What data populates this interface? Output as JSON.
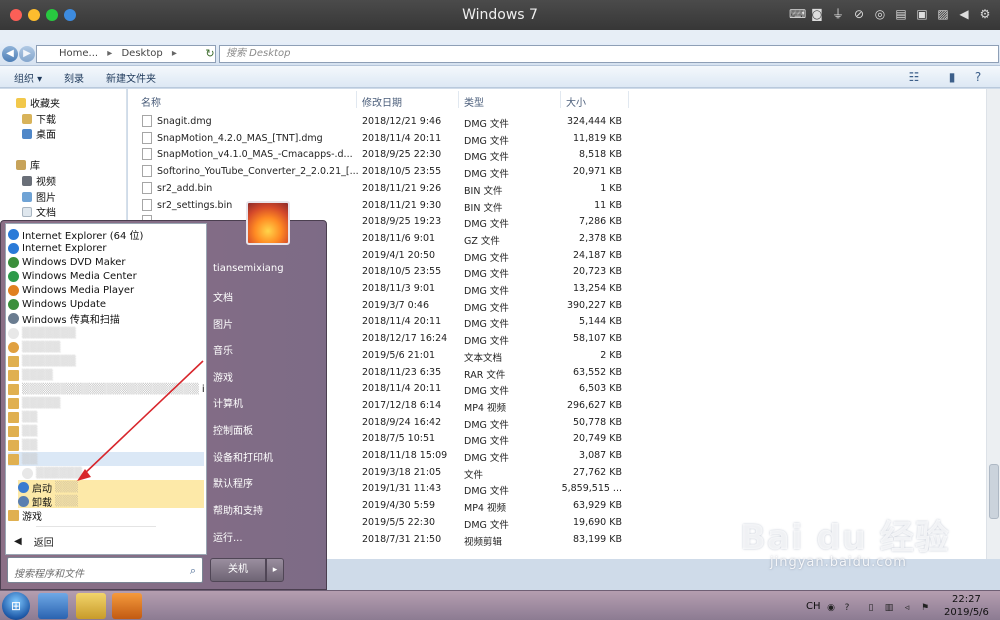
{
  "mac": {
    "title": "Windows 7"
  },
  "address": {
    "seg1": "Home...",
    "seg2": "Desktop",
    "search_placeholder": "搜索 Desktop"
  },
  "toolbar": {
    "organize": "组织 ▾",
    "burn": "刻录",
    "new_folder": "新建文件夹"
  },
  "nav": {
    "favorites": "收藏夹",
    "downloads": "下载",
    "desktop": "桌面",
    "libraries": "库",
    "videos": "视频",
    "pictures": "图片",
    "documents": "文档"
  },
  "columns": {
    "name": "名称",
    "date": "修改日期",
    "type": "类型",
    "size": "大小"
  },
  "files": [
    {
      "name": "Snagit.dmg",
      "date": "2018/12/21 9:46",
      "type": "DMG 文件",
      "size": "324,444 KB"
    },
    {
      "name": "SnapMotion_4.2.0_MAS_[TNT].dmg",
      "date": "2018/11/4 20:11",
      "type": "DMG 文件",
      "size": "11,819 KB"
    },
    {
      "name": "SnapMotion_v4.1.0_MAS_-Cmacapps-.d...",
      "date": "2018/9/25 22:30",
      "type": "DMG 文件",
      "size": "8,518 KB"
    },
    {
      "name": "Softorino_YouTube_Converter_2_2.0.21_[...",
      "date": "2018/10/5 23:55",
      "type": "DMG 文件",
      "size": "20,971 KB"
    },
    {
      "name": "sr2_add.bin",
      "date": "2018/11/21 9:26",
      "type": "BIN 文件",
      "size": "1 KB"
    },
    {
      "name": "sr2_settings.bin",
      "date": "2018/11/21 9:30",
      "type": "BIN 文件",
      "size": "11 KB"
    },
    {
      "name": "",
      "date": "2018/9/25 19:23",
      "type": "DMG 文件",
      "size": "7,286 KB"
    },
    {
      "name": "",
      "date": "2018/11/6 9:01",
      "type": "GZ 文件",
      "size": "2,378 KB"
    },
    {
      "name": "",
      "date": "2019/4/1 20:50",
      "type": "DMG 文件",
      "size": "24,187 KB"
    },
    {
      "name": "",
      "date": "2018/10/5 23:55",
      "type": "DMG 文件",
      "size": "20,723 KB"
    },
    {
      "name": "",
      "date": "2018/11/3 9:01",
      "type": "DMG 文件",
      "size": "13,254 KB"
    },
    {
      "name": "",
      "date": "2019/3/7 0:46",
      "type": "DMG 文件",
      "size": "390,227 KB"
    },
    {
      "name": "",
      "date": "2018/11/4 20:11",
      "type": "DMG 文件",
      "size": "5,144 KB"
    },
    {
      "name": "",
      "date": "2018/12/17 16:24",
      "type": "DMG 文件",
      "size": "58,107 KB"
    },
    {
      "name": "",
      "date": "2019/5/6 21:01",
      "type": "文本文档",
      "size": "2 KB"
    },
    {
      "name": "",
      "date": "2018/11/23 6:35",
      "type": "RAR 文件",
      "size": "63,552 KB"
    },
    {
      "name": "",
      "date": "2018/11/4 20:11",
      "type": "DMG 文件",
      "size": "6,503 KB"
    },
    {
      "name": "",
      "date": "2017/12/18 6:14",
      "type": "MP4 视频",
      "size": "296,627 KB"
    },
    {
      "name": "",
      "date": "2018/9/24 16:42",
      "type": "DMG 文件",
      "size": "50,778 KB"
    },
    {
      "name": "",
      "date": "2018/7/5 10:51",
      "type": "DMG 文件",
      "size": "20,749 KB"
    },
    {
      "name": "",
      "date": "2018/11/18 15:09",
      "type": "DMG 文件",
      "size": "3,087 KB"
    },
    {
      "name": "",
      "date": "2019/3/18 21:05",
      "type": "文件",
      "size": "27,762 KB"
    },
    {
      "name": "",
      "date": "2019/1/31 11:43",
      "type": "DMG 文件",
      "size": "5,859,515 ..."
    },
    {
      "name": "",
      "date": "2019/4/30 5:59",
      "type": "MP4 视频",
      "size": "63,929 KB"
    },
    {
      "name": "",
      "date": "2019/5/5 22:30",
      "type": "DMG 文件",
      "size": "19,690 KB"
    },
    {
      "name": "",
      "date": "2018/7/31 21:50",
      "type": "视频剪辑",
      "size": "83,199 KB"
    }
  ],
  "start_menu": {
    "programs": [
      {
        "label": "Internet Explorer (64 位)",
        "color": "#2a7ad8"
      },
      {
        "label": "Internet Explorer",
        "color": "#2a7ad8"
      },
      {
        "label": "Windows DVD Maker",
        "color": "#3b8f3b"
      },
      {
        "label": "Windows Media Center",
        "color": "#2d9a4a"
      },
      {
        "label": "Windows Media Player",
        "color": "#e08020"
      },
      {
        "label": "Windows Update",
        "color": "#3b8f3b"
      },
      {
        "label": "Windows 传真和扫描",
        "color": "#6a7c90"
      }
    ],
    "folder_suffix": "ises",
    "startup": "启动",
    "uninstall": "卸载",
    "games": "游戏",
    "back": "返回",
    "search_placeholder": "搜索程序和文件",
    "user": "tiansemixiang",
    "right_items": [
      "文档",
      "图片",
      "音乐",
      "游戏",
      "计算机",
      "控制面板",
      "设备和打印机",
      "默认程序",
      "帮助和支持",
      "运行..."
    ],
    "shutdown": "关机"
  },
  "taskbar": {
    "lang": "CH",
    "time": "22:27",
    "date": "2019/5/6"
  },
  "watermark": {
    "main": "Bai du 经验",
    "sub": "jingyan.baidu.com"
  }
}
